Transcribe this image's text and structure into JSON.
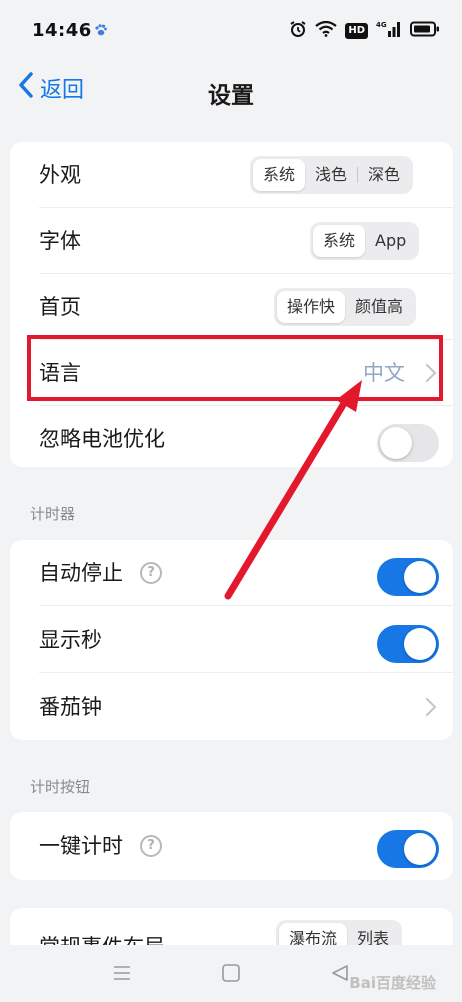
{
  "status": {
    "time": "14:46",
    "hd": "HD",
    "network": "4G"
  },
  "nav": {
    "back": "返回",
    "title": "设置"
  },
  "general": {
    "appearance": {
      "label": "外观",
      "options": [
        "系统",
        "浅色",
        "深色"
      ]
    },
    "font": {
      "label": "字体",
      "options": [
        "系统",
        "App"
      ]
    },
    "home": {
      "label": "首页",
      "options": [
        "操作快",
        "颜值高"
      ]
    },
    "language": {
      "label": "语言",
      "value": "中文"
    },
    "battery": {
      "label": "忽略电池优化",
      "on": false
    }
  },
  "timer": {
    "header": "计时器",
    "auto_stop": {
      "label": "自动停止",
      "on": true
    },
    "show_seconds": {
      "label": "显示秒",
      "on": true
    },
    "pomodoro": {
      "label": "番茄钟"
    }
  },
  "timer_button": {
    "header": "计时按钮",
    "one_click": {
      "label": "一键计时",
      "on": true
    }
  },
  "layout": {
    "label": "常规事件布局",
    "options": [
      "瀑布流",
      "列表"
    ]
  },
  "watermark": "Bai百度经验",
  "colors": {
    "accent": "#1677e5",
    "highlight": "#e4182d",
    "arrow": "#e4182d"
  }
}
